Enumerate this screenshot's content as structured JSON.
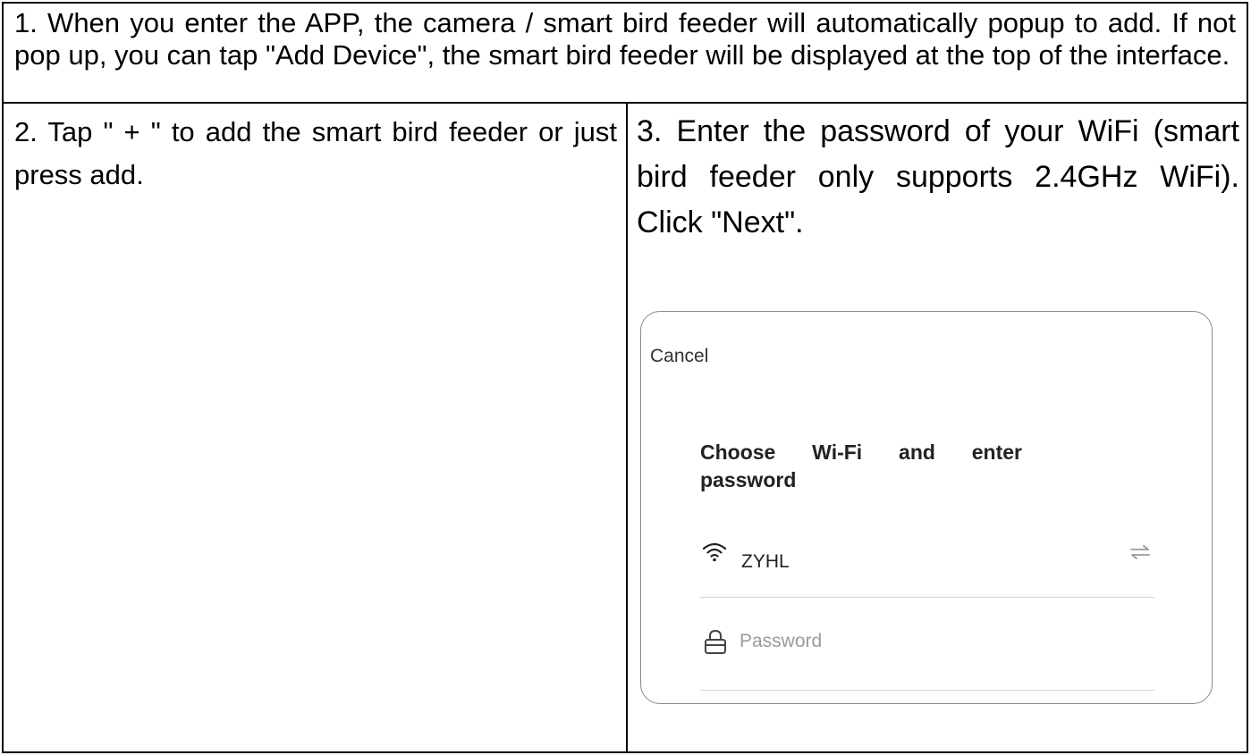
{
  "steps": {
    "step1": "1. When you enter the APP, the camera / smart bird feeder will automatically popup to add. If not pop up, you can tap \"Add Device\", the smart bird feeder will be displayed at the top of the interface.",
    "step2": "2. Tap \" + \" to add the smart bird feeder or just press add.",
    "step3": "3. Enter the password of your WiFi (smart bird feeder only supports 2.4GHz WiFi). Click \"Next\"."
  },
  "phone": {
    "cancel_label": "Cancel",
    "title": "Choose Wi-Fi and enter password",
    "wifi_name": "ZYHL",
    "password_placeholder": "Password",
    "icons": {
      "wifi": "wifi-icon",
      "switch": "switch-network-icon",
      "lock": "lock-icon"
    }
  }
}
